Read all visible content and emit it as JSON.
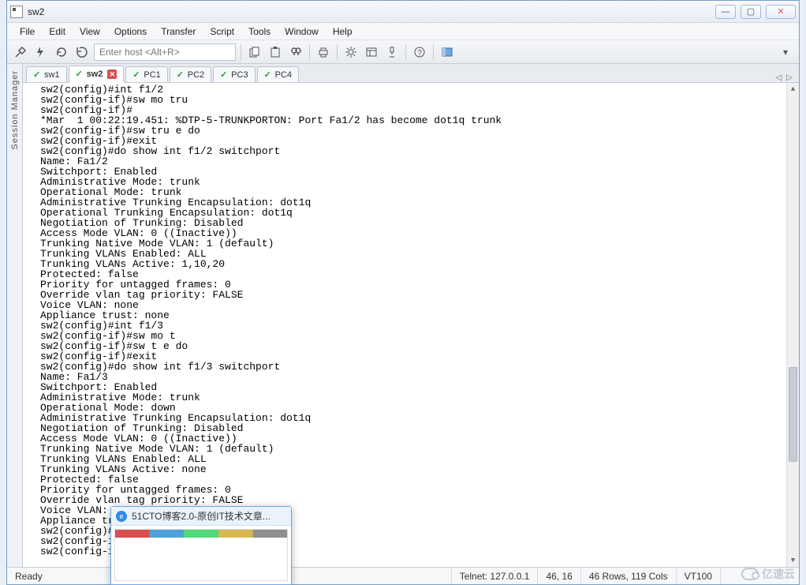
{
  "window": {
    "title": "sw2"
  },
  "menu": [
    "File",
    "Edit",
    "View",
    "Options",
    "Transfer",
    "Script",
    "Tools",
    "Window",
    "Help"
  ],
  "toolbar": {
    "host_placeholder": "Enter host <Alt+R>"
  },
  "session_manager_label": "Session Manager",
  "tabs": [
    {
      "label": "sw1",
      "active": false,
      "closeable": false
    },
    {
      "label": "sw2",
      "active": true,
      "closeable": true
    },
    {
      "label": "PC1",
      "active": false,
      "closeable": false
    },
    {
      "label": "PC2",
      "active": false,
      "closeable": false
    },
    {
      "label": "PC3",
      "active": false,
      "closeable": false
    },
    {
      "label": "PC4",
      "active": false,
      "closeable": false
    }
  ],
  "terminal_lines": [
    "sw2(config)#int f1/2",
    "sw2(config-if)#sw mo tru",
    "sw2(config-if)#",
    "*Mar  1 00:22:19.451: %DTP-5-TRUNKPORTON: Port Fa1/2 has become dot1q trunk",
    "sw2(config-if)#sw tru e do",
    "sw2(config-if)#exit",
    "sw2(config)#do show int f1/2 switchport",
    "Name: Fa1/2",
    "Switchport: Enabled",
    "Administrative Mode: trunk",
    "Operational Mode: trunk",
    "Administrative Trunking Encapsulation: dot1q",
    "Operational Trunking Encapsulation: dot1q",
    "Negotiation of Trunking: Disabled",
    "Access Mode VLAN: 0 ((Inactive))",
    "Trunking Native Mode VLAN: 1 (default)",
    "Trunking VLANs Enabled: ALL",
    "Trunking VLANs Active: 1,10,20",
    "Protected: false",
    "Priority for untagged frames: 0",
    "Override vlan tag priority: FALSE",
    "Voice VLAN: none",
    "Appliance trust: none",
    "sw2(config)#int f1/3",
    "sw2(config-if)#sw mo t",
    "sw2(config-if)#sw t e do",
    "sw2(config-if)#exit",
    "sw2(config)#do show int f1/3 switchport",
    "Name: Fa1/3",
    "Switchport: Enabled",
    "Administrative Mode: trunk",
    "Operational Mode: down",
    "Administrative Trunking Encapsulation: dot1q",
    "Negotiation of Trunking: Disabled",
    "Access Mode VLAN: 0 ((Inactive))",
    "Trunking Native Mode VLAN: 1 (default)",
    "Trunking VLANs Enabled: ALL",
    "Trunking VLANs Active: none",
    "Protected: false",
    "Priority for untagged frames: 0",
    "Override vlan tag priority: FALSE",
    "Voice VLAN: none",
    "Appliance trust: none",
    "sw2(config)#int f1/3",
    "sw2(config-if)#sw t e do",
    "sw2(config-if)#exit"
  ],
  "status": {
    "ready": "Ready",
    "connection": "Telnet: 127.0.0.1",
    "cursor": "46,  16",
    "size": "46 Rows, 119 Cols",
    "emu": "VT100"
  },
  "popup": {
    "title": "51CTO博客2.0-原创IT技术文章..."
  },
  "watermark": "亿速云"
}
